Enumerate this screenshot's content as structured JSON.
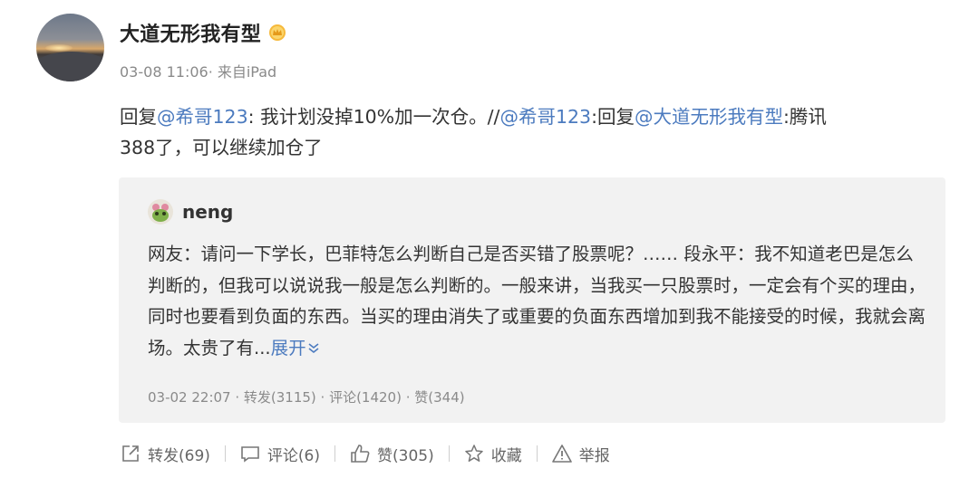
{
  "post": {
    "author": "大道无形我有型",
    "badge_icon": "vip-crown-icon",
    "timestamp": "03-08 11:06",
    "source": "· 来自iPad",
    "text": {
      "reply_prefix": "回复",
      "mention1": "@希哥123",
      "segment1": ": 我计划没掉10%加一次仓。//",
      "mention2": "@希哥123",
      "segment2": ":回复",
      "mention3": "@大道无形我有型",
      "segment3": ":腾讯",
      "line2": "388了，可以继续加仓了"
    }
  },
  "quoted": {
    "author": "neng",
    "text": "网友：请问一下学长，巴菲特怎么判断自己是否买错了股票呢？…… 段永平：我不知道老巴是怎么判断的，但我可以说说我一般是怎么判断的。一般来讲，当我买一只股票时，一定会有个买的理由，同时也要看到负面的东西。当买的理由消失了或重要的负面东西增加到我不能接受的时候，我就会离场。太贵了有...",
    "expand_label": "展开",
    "meta": "03-02 22:07  · 转发(3115) · 评论(1420) · 赞(344)"
  },
  "actions": {
    "repost": "转发(69)",
    "comment": "评论(6)",
    "like": "赞(305)",
    "favorite": "收藏",
    "report": "举报"
  },
  "colors": {
    "link": "#4c7bbf",
    "meta_gray": "#8a8a8a",
    "quote_bg": "#f2f2f2"
  }
}
